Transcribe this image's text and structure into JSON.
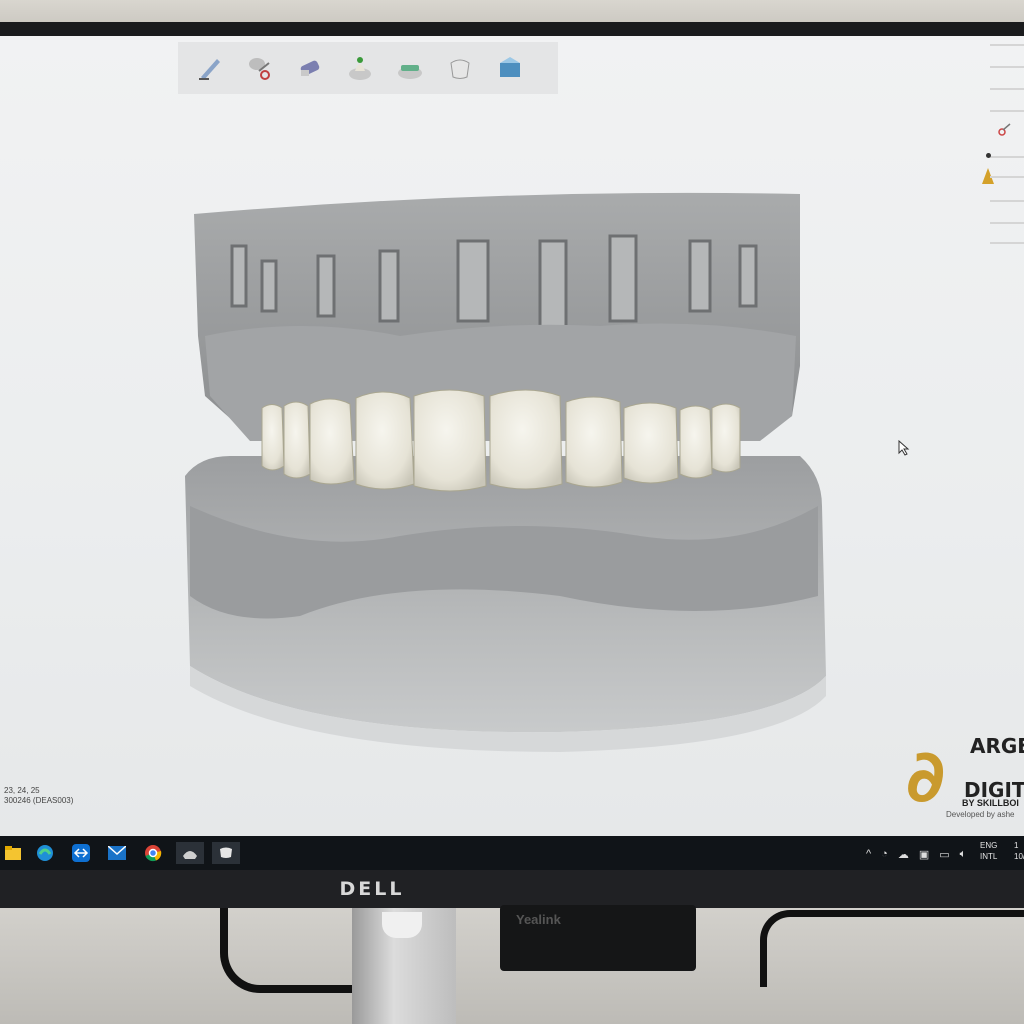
{
  "monitor": {
    "brand": "DELL"
  },
  "phone": {
    "label": "Yealink"
  },
  "app": {
    "toolbar": {
      "tools": [
        {
          "name": "margin-pen-icon"
        },
        {
          "name": "scissors-tooth-icon"
        },
        {
          "name": "wax-knife-icon"
        },
        {
          "name": "crown-anatomy-icon"
        },
        {
          "name": "bridge-connector-icon"
        },
        {
          "name": "single-crown-icon"
        },
        {
          "name": "export-box-icon"
        }
      ]
    },
    "info_lines": [
      "23, 24, 25",
      "300246 (DEAS003)"
    ],
    "logo": {
      "line1": "ARGE",
      "line2": "DIGITA",
      "line3": "BY SKILLBOI",
      "line4": "Developed by ashe",
      "accent": "#c99a2e"
    }
  },
  "taskbar": {
    "lang": [
      "ENG",
      "INTL"
    ],
    "clock": [
      "1",
      "10/"
    ]
  }
}
